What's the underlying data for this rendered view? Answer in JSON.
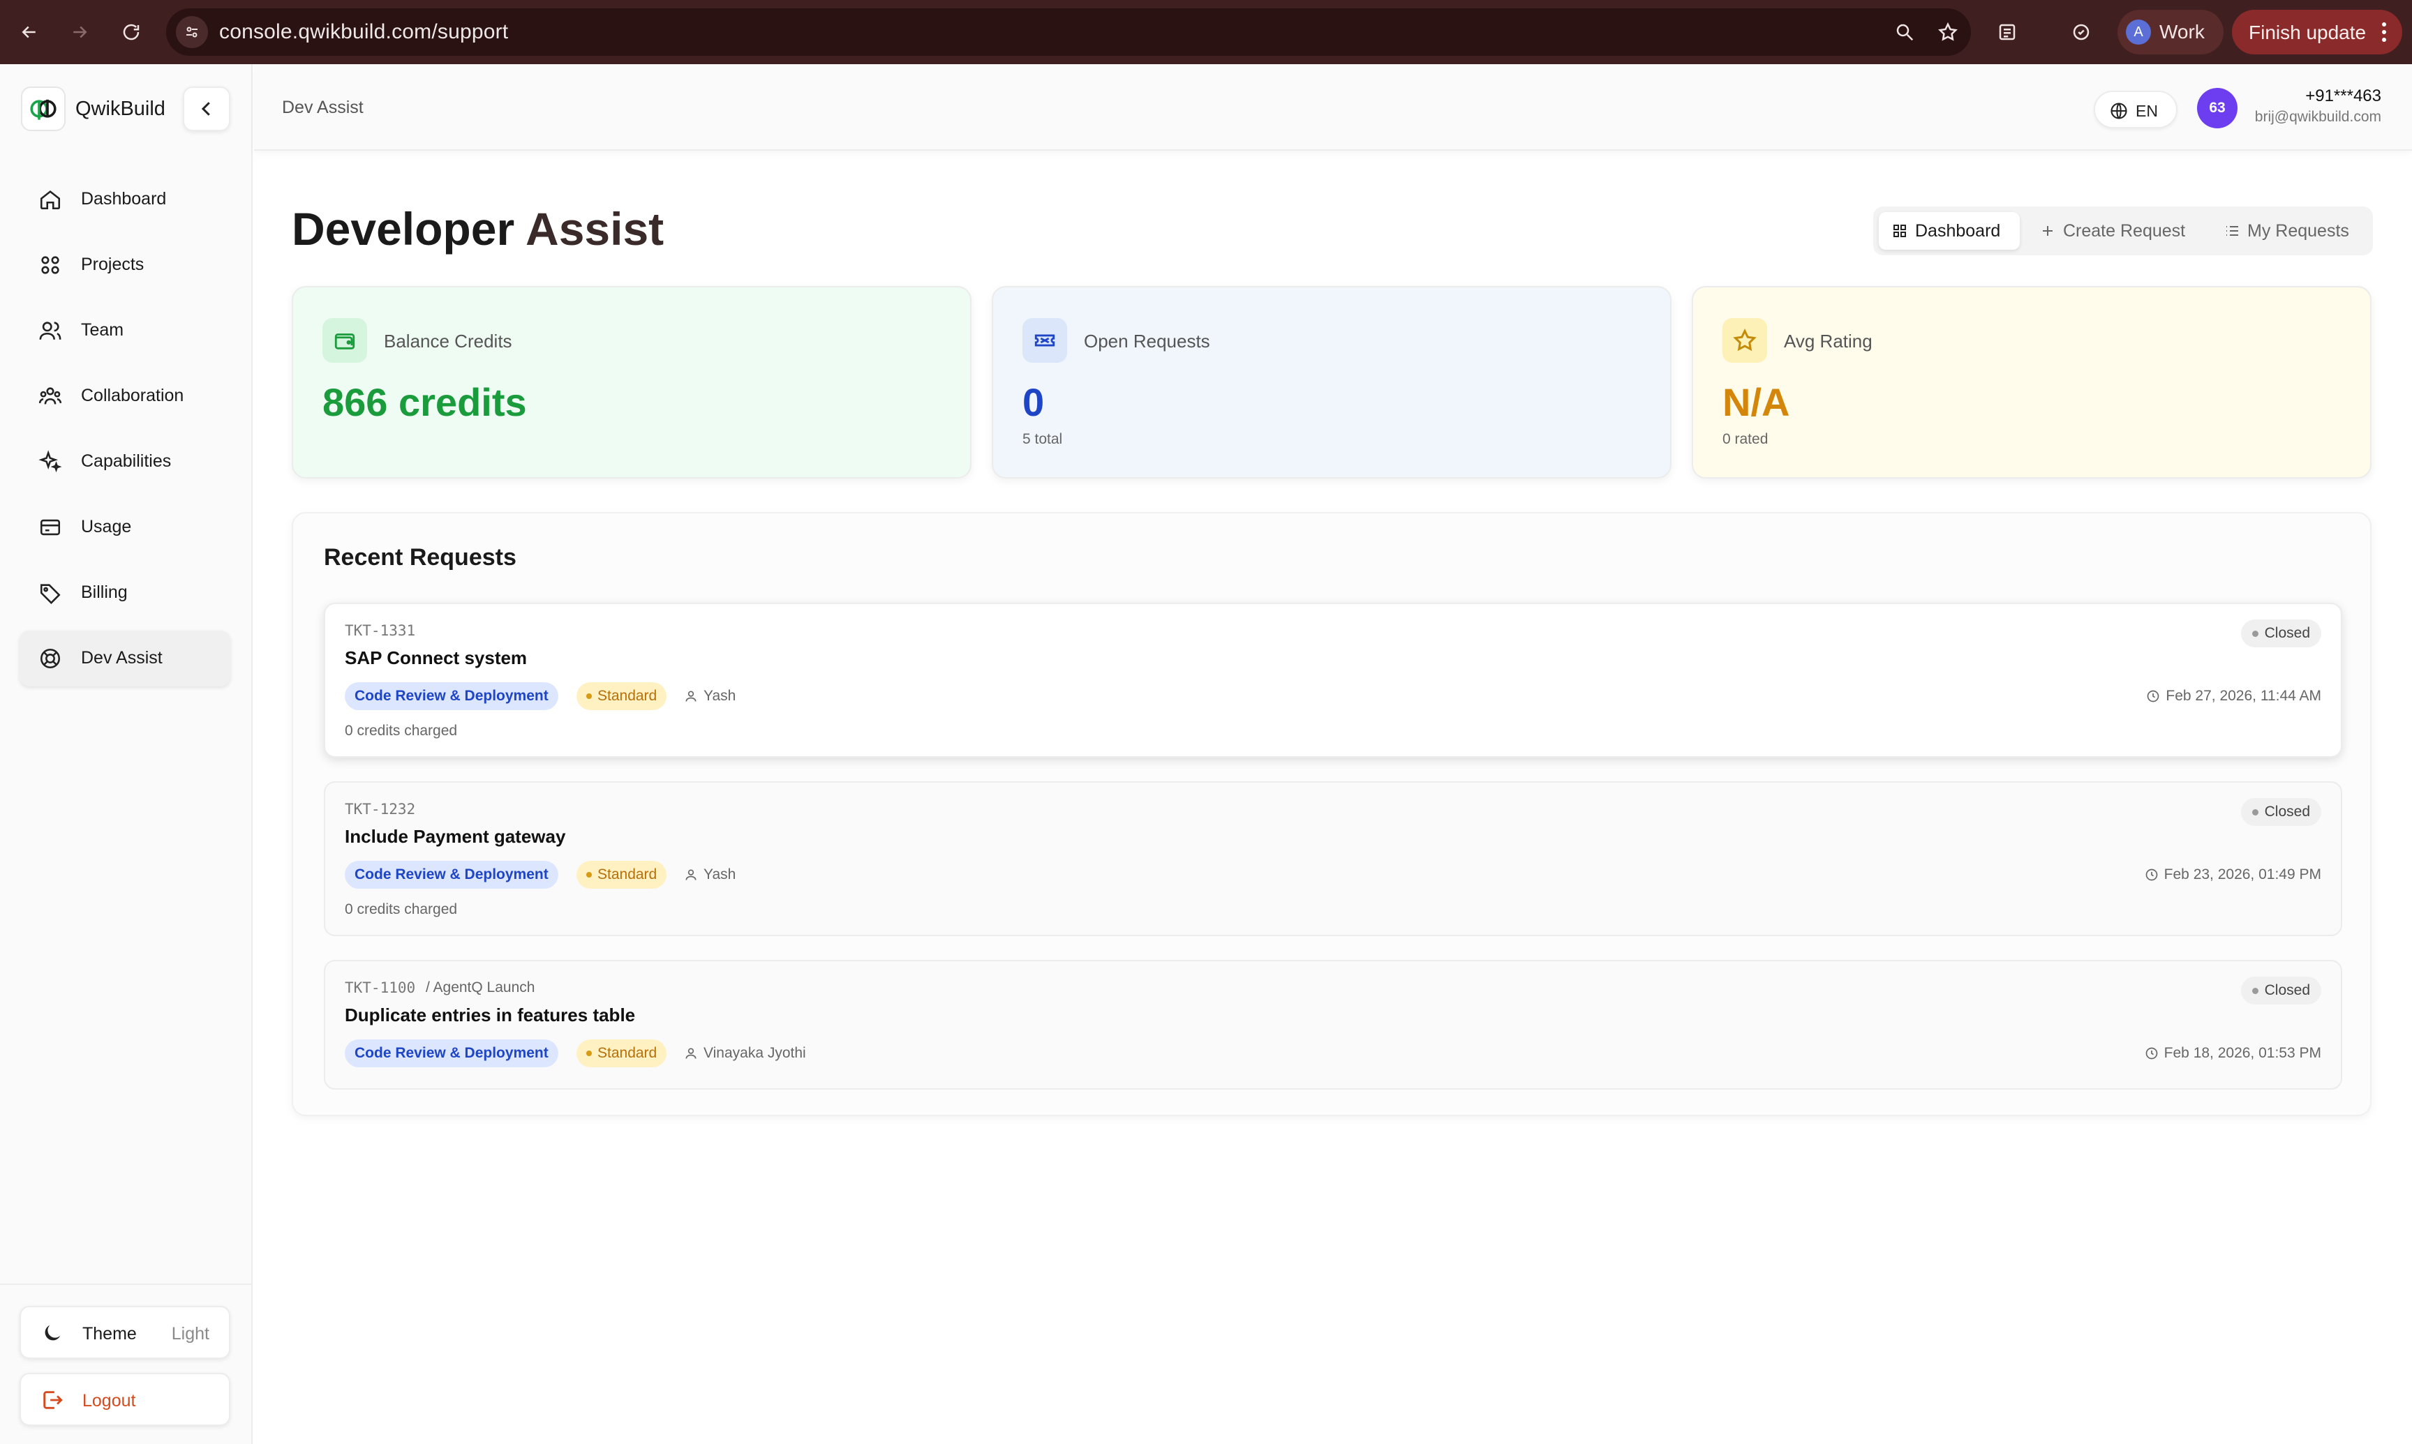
{
  "browser": {
    "url": "console.qwikbuild.com/support",
    "profile_initial": "A",
    "profile_label": "Work",
    "update_label": "Finish update"
  },
  "sidebar": {
    "brand": "QwikBuild",
    "items": [
      {
        "label": "Dashboard",
        "icon": "home-icon"
      },
      {
        "label": "Projects",
        "icon": "grid-icon"
      },
      {
        "label": "Team",
        "icon": "users-icon"
      },
      {
        "label": "Collaboration",
        "icon": "group-icon"
      },
      {
        "label": "Capabilities",
        "icon": "sparkles-icon"
      },
      {
        "label": "Usage",
        "icon": "card-icon"
      },
      {
        "label": "Billing",
        "icon": "tag-icon"
      },
      {
        "label": "Dev Assist",
        "icon": "lifebuoy-icon",
        "active": true
      }
    ],
    "theme_label": "Theme",
    "theme_value": "Light",
    "logout_label": "Logout"
  },
  "topbar": {
    "breadcrumb": "Dev Assist",
    "language": "EN",
    "avatar_text": "63",
    "phone": "+91***463",
    "email": "brij@qwikbuild.com"
  },
  "page": {
    "title_part1": "Developer",
    "title_part2": "Assist",
    "tabs": [
      {
        "label": "Dashboard",
        "active": true
      },
      {
        "label": "Create Request"
      },
      {
        "label": "My Requests"
      }
    ]
  },
  "stats": [
    {
      "label": "Balance Credits",
      "value": "866 credits",
      "sub": "",
      "color": "#1a9b3c",
      "bg": "#effcf3",
      "icon": "wallet-icon"
    },
    {
      "label": "Open Requests",
      "value": "0",
      "sub": "5 total",
      "color": "#1f45c7",
      "bg": "#f1f6fd",
      "icon": "ticket-icon"
    },
    {
      "label": "Avg Rating",
      "value": "N/A",
      "sub": "0 rated",
      "color": "#d4860b",
      "bg": "#fffceb",
      "icon": "star-icon"
    }
  ],
  "recent": {
    "title": "Recent Requests",
    "requests": [
      {
        "id": "TKT-1331",
        "project": "",
        "title": "SAP Connect system",
        "category": "Code Review & Deployment",
        "priority": "Standard",
        "assignee": "Yash",
        "credits": "0 credits charged",
        "status": "Closed",
        "date": "Feb 27, 2026, 11:44 AM"
      },
      {
        "id": "TKT-1232",
        "project": "",
        "title": "Include Payment gateway",
        "category": "Code Review & Deployment",
        "priority": "Standard",
        "assignee": "Yash",
        "credits": "0 credits charged",
        "status": "Closed",
        "date": "Feb 23, 2026, 01:49 PM"
      },
      {
        "id": "TKT-1100",
        "project": "/ AgentQ Launch",
        "title": "Duplicate entries in features table",
        "category": "Code Review & Deployment",
        "priority": "Standard",
        "assignee": "Vinayaka Jyothi",
        "credits": "",
        "status": "Closed",
        "date": "Feb 18, 2026, 01:53 PM"
      }
    ]
  }
}
